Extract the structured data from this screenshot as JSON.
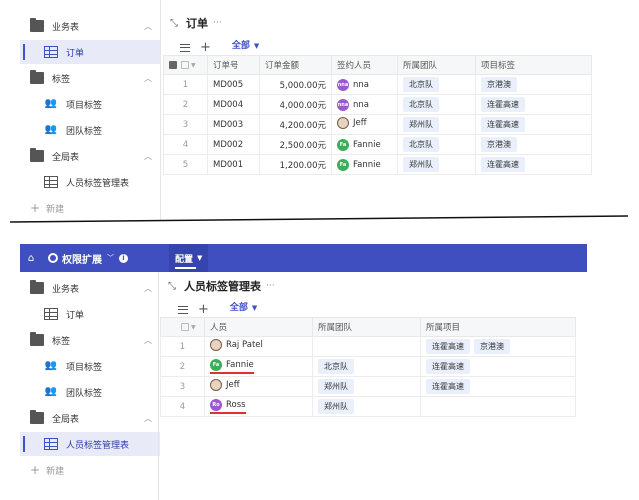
{
  "top": {
    "sidebar": {
      "items": [
        {
          "label": "业务表",
          "icon": "folder-icon"
        },
        {
          "label": "订单",
          "icon": "table-icon"
        },
        {
          "label": "标签",
          "icon": "folder-icon"
        },
        {
          "label": "项目标签",
          "icon": "users-icon"
        },
        {
          "label": "团队标签",
          "icon": "users-icon"
        },
        {
          "label": "全局表",
          "icon": "folder-icon"
        },
        {
          "label": "人员标签管理表",
          "icon": "table-icon"
        }
      ],
      "new_label": "新建"
    },
    "title": "订单",
    "tab_label": "全部",
    "table": {
      "headers": [
        "订单号",
        "订单金额",
        "签约人员",
        "所属团队",
        "项目标签"
      ],
      "rows": [
        {
          "no": "1",
          "id": "MD005",
          "amount": "5,000.00元",
          "avatar": "nna",
          "person": "nna",
          "team": "北京队",
          "tag": "京港澳"
        },
        {
          "no": "2",
          "id": "MD004",
          "amount": "4,000.00元",
          "avatar": "nna",
          "person": "nna",
          "team": "北京队",
          "tag": "连霍高速"
        },
        {
          "no": "3",
          "id": "MD003",
          "amount": "4,200.00元",
          "avatar": "",
          "person": "Jeff",
          "team": "郑州队",
          "tag": "连霍高速"
        },
        {
          "no": "4",
          "id": "MD002",
          "amount": "2,500.00元",
          "avatar": "Fa",
          "person": "Fannie",
          "team": "北京队",
          "tag": "京港澳"
        },
        {
          "no": "5",
          "id": "MD001",
          "amount": "1,200.00元",
          "avatar": "Fa",
          "person": "Fannie",
          "team": "郑州队",
          "tag": "连霍高速"
        }
      ]
    }
  },
  "bottom": {
    "navbar": {
      "title": "权限扩展",
      "tab": "配置"
    },
    "sidebar": {
      "items": [
        {
          "label": "业务表",
          "icon": "folder-icon"
        },
        {
          "label": "订单",
          "icon": "table-icon"
        },
        {
          "label": "标签",
          "icon": "folder-icon"
        },
        {
          "label": "项目标签",
          "icon": "users-icon"
        },
        {
          "label": "团队标签",
          "icon": "users-icon"
        },
        {
          "label": "全局表",
          "icon": "folder-icon"
        },
        {
          "label": "人员标签管理表",
          "icon": "table-icon"
        }
      ],
      "new_label": "新建"
    },
    "title": "人员标签管理表",
    "tab_label": "全部",
    "table": {
      "headers": [
        "人员",
        "所属团队",
        "所属项目"
      ],
      "rows": [
        {
          "no": "1",
          "avatar": "",
          "person": "Raj Patel",
          "team": "",
          "projects": [
            "连霍高速",
            "京港澳"
          ]
        },
        {
          "no": "2",
          "avatar": "Fa",
          "person": "Fannie",
          "team": "北京队",
          "projects": [
            "连霍高速"
          ]
        },
        {
          "no": "3",
          "avatar": "",
          "person": "Jeff",
          "team": "郑州队",
          "projects": [
            "连霍高速"
          ]
        },
        {
          "no": "4",
          "avatar": "Ro",
          "person": "Ross",
          "team": "郑州队",
          "projects": []
        }
      ]
    }
  }
}
